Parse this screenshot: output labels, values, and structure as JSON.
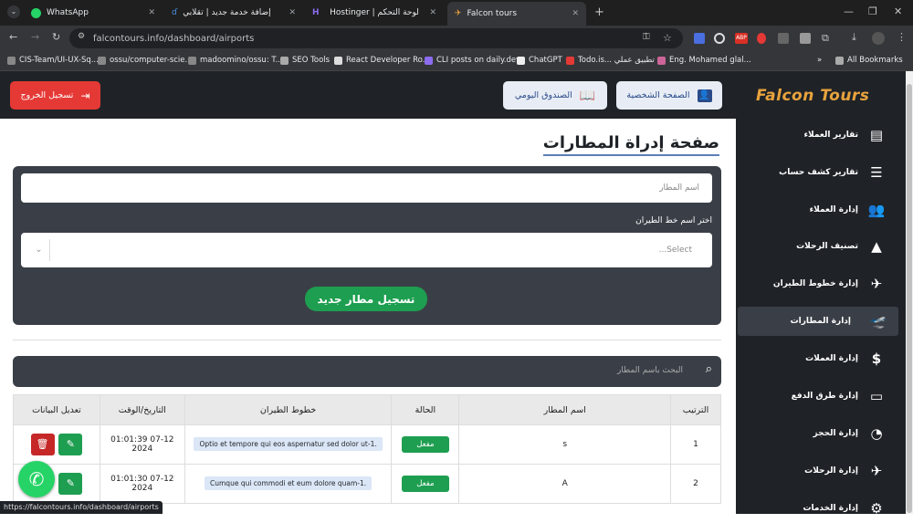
{
  "browser": {
    "tabs": [
      {
        "label": "WhatsApp"
      },
      {
        "label": "إضافة خدمة جديد | تقلابي"
      },
      {
        "label": "Hostinger | لوحة التحكم"
      },
      {
        "label": "Falcon tours"
      }
    ],
    "url": "falcontours.info/dashboard/airports",
    "bookmarks": [
      "CIS-Team/UI-UX-Sq...",
      "ossu/computer-scie...",
      "madoomino/ossu: T...",
      "SEO Tools",
      "React Developer Ro...",
      "CLI posts on daily.dev",
      "ChatGPT",
      "Todo.is... تطبيق عملي",
      "Eng. Mohamed glal...",
      "All Bookmarks"
    ],
    "status_url": "https://falcontours.info/dashboard/airports"
  },
  "header": {
    "logo": "Falcon Tours",
    "profile_label": "الصفحة الشخصية",
    "daily_box_label": "الصندوق اليومي",
    "logout_label": "تسجيل الخروج"
  },
  "sidebar": {
    "items": [
      {
        "label": "تقارير العملاء",
        "icon": "report-icon"
      },
      {
        "label": "تقارير كشف حساب",
        "icon": "statement-icon"
      },
      {
        "label": "إدارة العملاء",
        "icon": "users-icon"
      },
      {
        "label": "تصنيف الرحلات",
        "icon": "shapes-icon"
      },
      {
        "label": "إدارة خطوط الطيران",
        "icon": "airline-icon"
      },
      {
        "label": "إدارة المطارات",
        "icon": "plane-departure-icon",
        "active": true
      },
      {
        "label": "إدارة العملات",
        "icon": "dollar-icon"
      },
      {
        "label": "إدارة طرق الدفع",
        "icon": "card-icon"
      },
      {
        "label": "إدارة الحجز",
        "icon": "booking-icon"
      },
      {
        "label": "إدارة الرحلات",
        "icon": "plane-icon"
      },
      {
        "label": "إدارة الخدمات",
        "icon": "gears-icon"
      }
    ]
  },
  "main": {
    "title": "صفحة إدراة المطارات",
    "airport_name_placeholder": "اسم المطار",
    "airline_select_label": "اختر اسم خط الطيران",
    "airline_select_placeholder": "...Select",
    "submit_label": "تسجيل مطار جديد",
    "search_placeholder": "البحث باسم المطار",
    "table": {
      "headers": [
        "الترتيب",
        "اسم المطار",
        "الحالة",
        "خطوط الطيران",
        "التاريخ/الوقت",
        "تعديل البيانات"
      ],
      "rows": [
        {
          "index": "1",
          "name": "s",
          "status": "مفعل",
          "airline": "Optio et tempore qui eos aspernatur sed dolor ut-1.",
          "datetime": "01:01:39 07-12 2024"
        },
        {
          "index": "2",
          "name": "A",
          "status": "مفعل",
          "airline": "Cumque qui commodi et eum dolore quam-1.",
          "datetime": "01:01:30 07-12 2024"
        }
      ]
    }
  },
  "colors": {
    "sidebar_bg": "#1f2328",
    "accent_green": "#1e9e50",
    "logout_red": "#e53935",
    "logo_orange": "#e8a33d"
  }
}
